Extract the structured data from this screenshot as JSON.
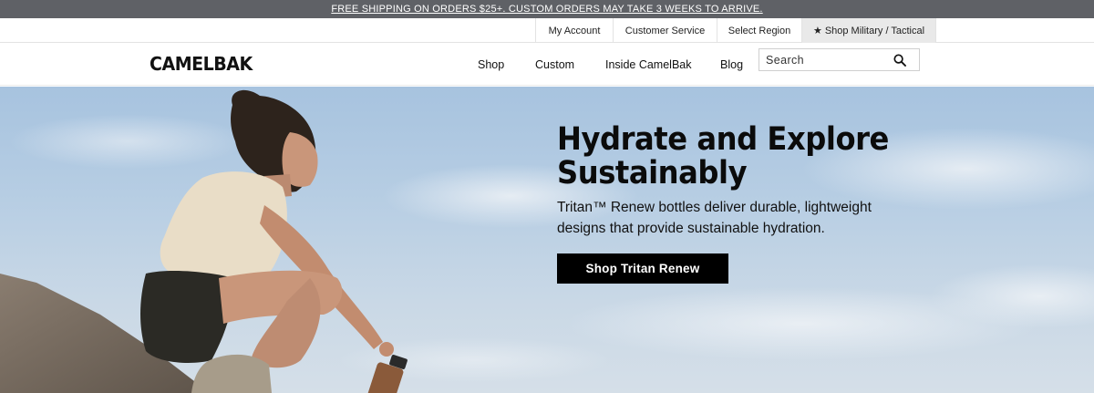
{
  "promo": {
    "text": "FREE SHIPPING ON ORDERS $25+. CUSTOM ORDERS MAY TAKE 3 WEEKS TO ARRIVE."
  },
  "utility": {
    "my_account": "My Account",
    "customer_service": "Customer Service",
    "select_region": "Select Region",
    "shop_military": "Shop Military / Tactical"
  },
  "header": {
    "logo": "CAMELBAK",
    "nav": [
      "Shop",
      "Custom",
      "Inside CamelBak",
      "Blog"
    ],
    "search_placeholder": "Search"
  },
  "hero": {
    "title": "Hydrate and Explore Sustainably",
    "subtitle": "Tritan™ Renew bottles deliver durable, lightweight designs that provide sustainable hydration.",
    "cta": "Shop Tritan Renew"
  },
  "icons": {
    "star": "star-icon",
    "search": "search-icon"
  }
}
